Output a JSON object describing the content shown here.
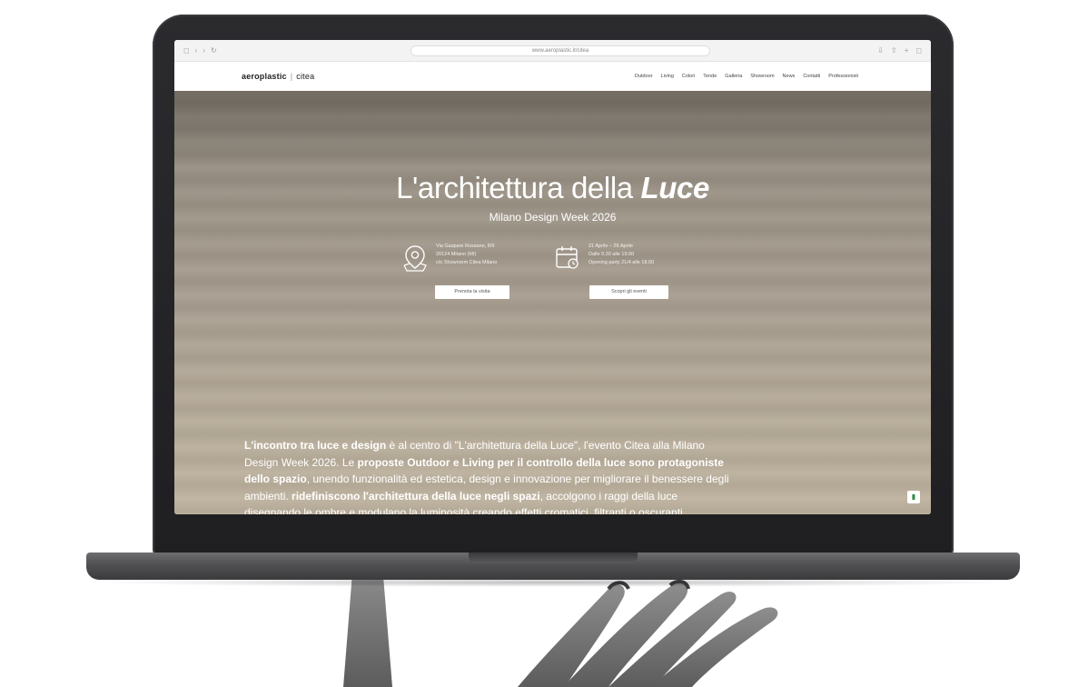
{
  "browser": {
    "url": "www.aeroplastic.it/citea",
    "left_glyphs": [
      "◻",
      "‹",
      "›",
      "↻"
    ],
    "right_glyphs": [
      "⇩",
      "⇧",
      "+",
      "◻"
    ]
  },
  "site": {
    "logo_main": "aeroplastic",
    "logo_sep": "|",
    "logo_sub": "citea",
    "nav": [
      "Outdoor",
      "Living",
      "Colori",
      "Tende",
      "Galleria",
      "Showroom",
      "News",
      "Contatti",
      "Professionisti"
    ]
  },
  "hero": {
    "title_plain": "L'architettura della ",
    "title_em": "Luce",
    "subtitle": "Milano Design Week 2026",
    "location": {
      "lines": [
        "Via Gaspare Rossano, 8/9",
        "20124 Milano (MI)",
        "c/o Showroom Citea Milano"
      ],
      "button": "Prenota la visita"
    },
    "dates": {
      "lines": [
        "21 Aprile – 26 Aprile",
        "Dalle 9.30 alle 19.00",
        "Opening party 21/4 alle 18.00"
      ],
      "button": "Scopri gli eventi"
    }
  },
  "body": {
    "p1_b1": "L'incontro tra luce e design",
    "p1_t1": " è al centro di \"L'architettura della Luce\", l'evento Citea alla Milano Design Week 2026. Le ",
    "p1_b2": "proposte Outdoor e Living per il controllo della luce sono protagoniste dello spazio",
    "p1_t2": ", unendo funzionalità ed estetica, design e innovazione per migliorare il benessere degli ambienti. ",
    "p1_b3": "ridefiniscono l'architettura della luce negli spazi",
    "p1_t3": ", accolgono i raggi della luce disegnando le ombre e modulano la luminosità creando effetti cromatici, filtranti o oscuranti."
  },
  "chat_badge": "▮",
  "colors": {
    "bezel": "#1f1f22",
    "hero_top": "#8b8479",
    "hero_bottom": "#bfb39f",
    "chassis": "#505053"
  }
}
